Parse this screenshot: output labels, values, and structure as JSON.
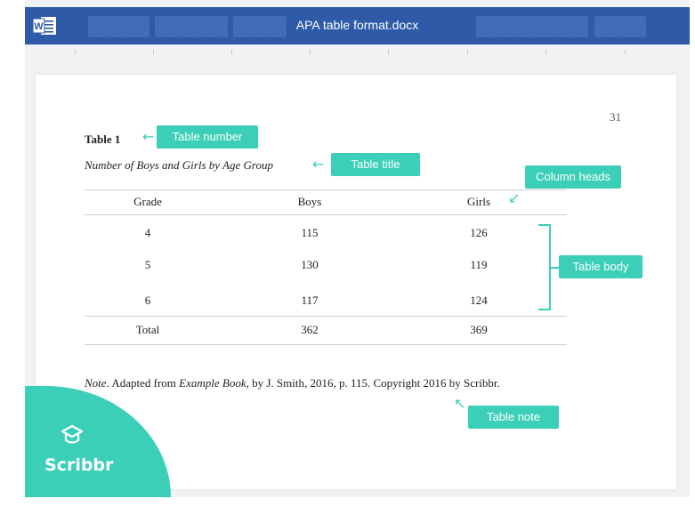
{
  "window": {
    "title": "APA table format.docx",
    "app_icon": "word-icon"
  },
  "page": {
    "number": "31"
  },
  "table": {
    "label": "Table 1",
    "title": "Number of Boys and Girls by Age Group",
    "headers": [
      "Grade",
      "Boys",
      "Girls"
    ],
    "rows": [
      [
        "4",
        "115",
        "126"
      ],
      [
        "5",
        "130",
        "119"
      ],
      [
        "6",
        "117",
        "124"
      ]
    ],
    "total": [
      "Total",
      "362",
      "369"
    ],
    "note": {
      "prefix": "Note",
      "text1": ". Adapted from ",
      "book": "Example Book",
      "text2": ", by J. Smith, 2016, p. 115. Copyright 2016 by Scribbr."
    }
  },
  "annotations": {
    "table_number": "Table number",
    "table_title": "Table title",
    "column_heads": "Column heads",
    "table_body": "Table body",
    "table_note": "Table note"
  },
  "brand": {
    "name": "Scribbr",
    "accent": "#3ccfb8",
    "bar_color": "#2e5aa8"
  }
}
